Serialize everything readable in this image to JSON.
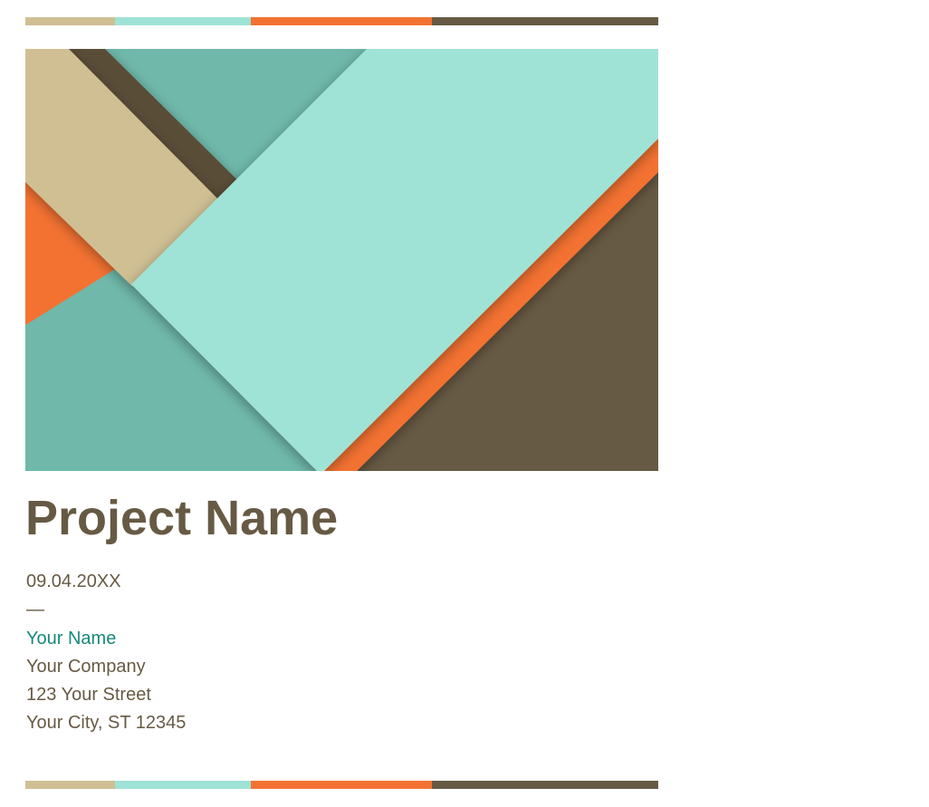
{
  "palette": {
    "sand": "#cfbf93",
    "mint": "#9fe3d6",
    "orange": "#f37232",
    "brown": "#675a44",
    "teal": "#6fb8aa",
    "accent_text": "#17897c"
  },
  "cover": {
    "title": "Project Name",
    "date": "09.04.20XX",
    "separator": "—",
    "author_name": "Your Name",
    "company": "Your Company",
    "street": "123 Your Street",
    "city_line": "Your City, ST 12345"
  }
}
